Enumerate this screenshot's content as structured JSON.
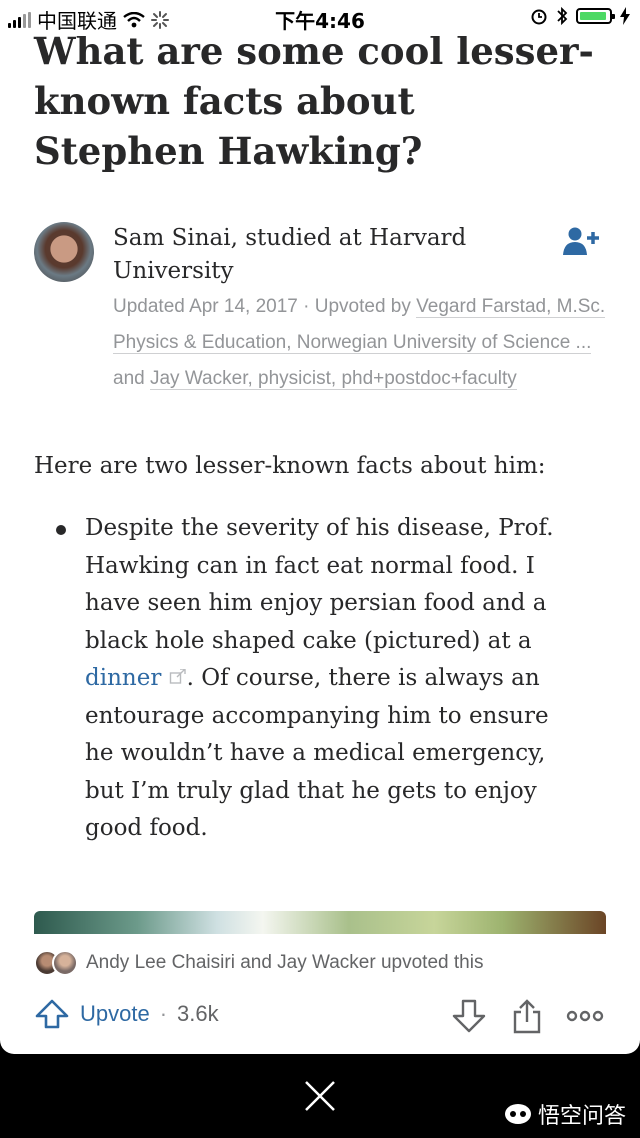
{
  "status_bar": {
    "carrier": "中国联通",
    "time": "下午4:46"
  },
  "question": {
    "title": "What are some cool lesser-known facts about Stephen Hawking?"
  },
  "answer": {
    "author_line": "Sam Sinai, studied at Harvard University",
    "meta": {
      "updated": "Updated Apr 14, 2017",
      "dot": " · ",
      "upvoted_by": "Upvoted by ",
      "upvoter1": "Vegard Farstad, M.Sc. Physics & Education, Norwegian University of Science ...",
      "and_text": " and ",
      "upvoter2": "Jay Wacker, physicist, phd+postdoc+faculty"
    },
    "intro": "Here are two lesser-known facts about him:",
    "bullet_before": "Despite the severity of his disease, Prof. Hawking can in fact eat normal food. I have seen him enjoy persian food and a black hole shaped cake (pictured) at a ",
    "bullet_link": "dinner",
    "bullet_after": ". Of course, there is always an entourage accompanying him to ensure he wouldn’t have a medical emergency, but I’m truly glad that he gets to enjoy good food.",
    "upvoters_text": "Andy Lee Chaisiri and Jay Wacker upvoted this"
  },
  "actions": {
    "upvote_label": "Upvote",
    "separator": "·",
    "upvote_count": "3.6k"
  },
  "watermark": "悟空问答",
  "colors": {
    "link": "#2e69a3",
    "meta": "#939598",
    "text": "#282829",
    "battery": "#4cd964"
  },
  "icons": [
    "signal-icon",
    "wifi-icon",
    "loading-icon",
    "alarm-icon",
    "bluetooth-icon",
    "battery-icon",
    "charging-icon",
    "follow-icon",
    "external-link-icon",
    "upvote-icon",
    "downvote-icon",
    "share-icon",
    "more-icon",
    "close-icon",
    "wukong-logo-icon"
  ]
}
